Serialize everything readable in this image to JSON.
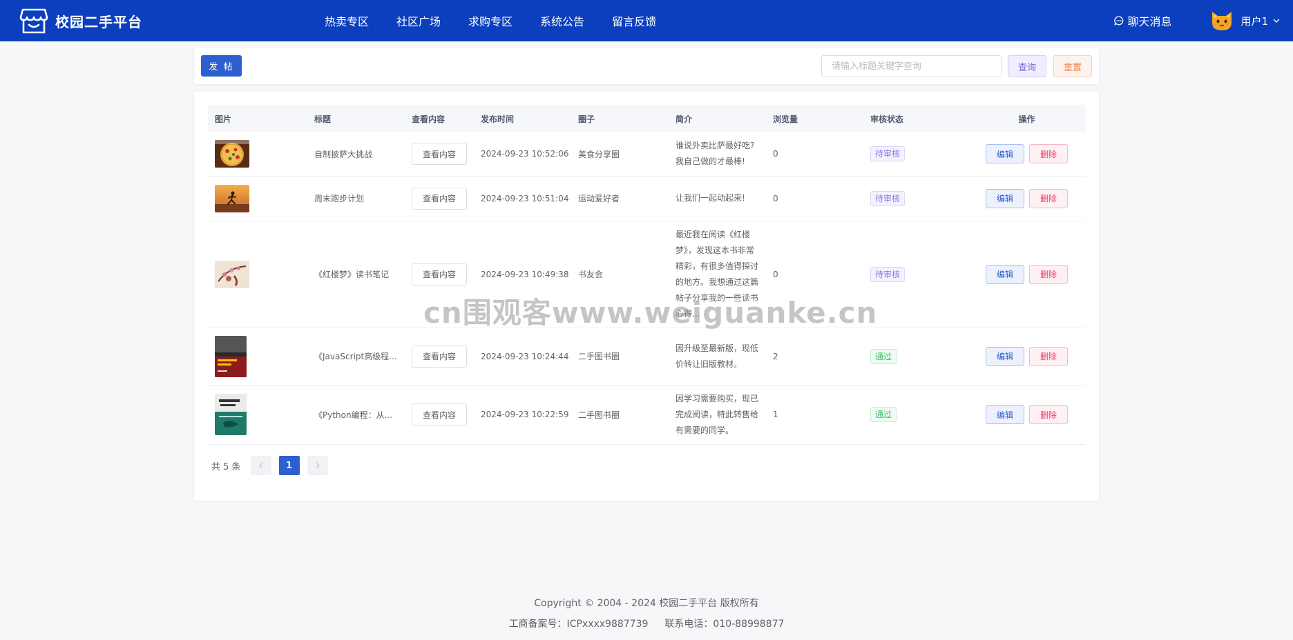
{
  "header": {
    "title": "校园二手平台",
    "nav": [
      "热卖专区",
      "社区广场",
      "求购专区",
      "系统公告",
      "留言反馈"
    ],
    "chat_label": "聊天消息",
    "username": "用户1"
  },
  "toolbar": {
    "post_label": "发 帖",
    "search_placeholder": "请输入标题关键字查询",
    "query_label": "查询",
    "reset_label": "重置"
  },
  "table": {
    "columns": [
      "图片",
      "标题",
      "查看内容",
      "发布时间",
      "圈子",
      "简介",
      "浏览量",
      "审核状态",
      "操作"
    ],
    "view_label": "查看内容",
    "edit_label": "编辑",
    "delete_label": "删除",
    "rows": [
      {
        "title": "自制披萨大挑战",
        "time": "2024-09-23 10:52:06",
        "circle": "美食分享圈",
        "intro": "谁说外卖比萨最好吃?我自己做的才最棒!",
        "views": "0",
        "status": "待审核",
        "status_type": "pending",
        "thumb": "pizza"
      },
      {
        "title": "周末跑步计划",
        "time": "2024-09-23 10:51:04",
        "circle": "运动爱好者",
        "intro": "让我们一起动起来!",
        "views": "0",
        "status": "待审核",
        "status_type": "pending",
        "thumb": "running"
      },
      {
        "title": "《红楼梦》读书笔记",
        "time": "2024-09-23 10:49:38",
        "circle": "书友会",
        "intro": "最近我在阅读《红楼梦》，发现这本书非常精彩，有很多值得探讨的地方。我想通过这篇帖子分享我的一些读书心得...",
        "views": "0",
        "status": "待审核",
        "status_type": "pending",
        "thumb": "painting"
      },
      {
        "title": "《JavaScript高级程...",
        "time": "2024-09-23 10:24:44",
        "circle": "二手图书圈",
        "intro": "因升级至最新版，现低价转让旧版教材。",
        "views": "2",
        "status": "通过",
        "status_type": "pass",
        "thumb": "book-js"
      },
      {
        "title": "《Python编程：从...",
        "time": "2024-09-23 10:22:59",
        "circle": "二手图书圈",
        "intro": "因学习需要购买，现已完成阅读，特此转售给有需要的同学。",
        "views": "1",
        "status": "通过",
        "status_type": "pass",
        "thumb": "book-py"
      }
    ]
  },
  "pagination": {
    "total": "共 5 条",
    "current": "1"
  },
  "watermark": "cn围观客www.weiguanke.cn",
  "footer": {
    "copyright": "Copyright © 2004 - 2024 校园二手平台 版权所有",
    "icp": "工商备案号：ICPxxxx9887739",
    "phone": "联系电话：010-88998877"
  },
  "colors": {
    "header_bg": "#0b3fbd",
    "primary": "#2d5fd0",
    "danger": "#e8426b",
    "success": "#3cb86c"
  }
}
